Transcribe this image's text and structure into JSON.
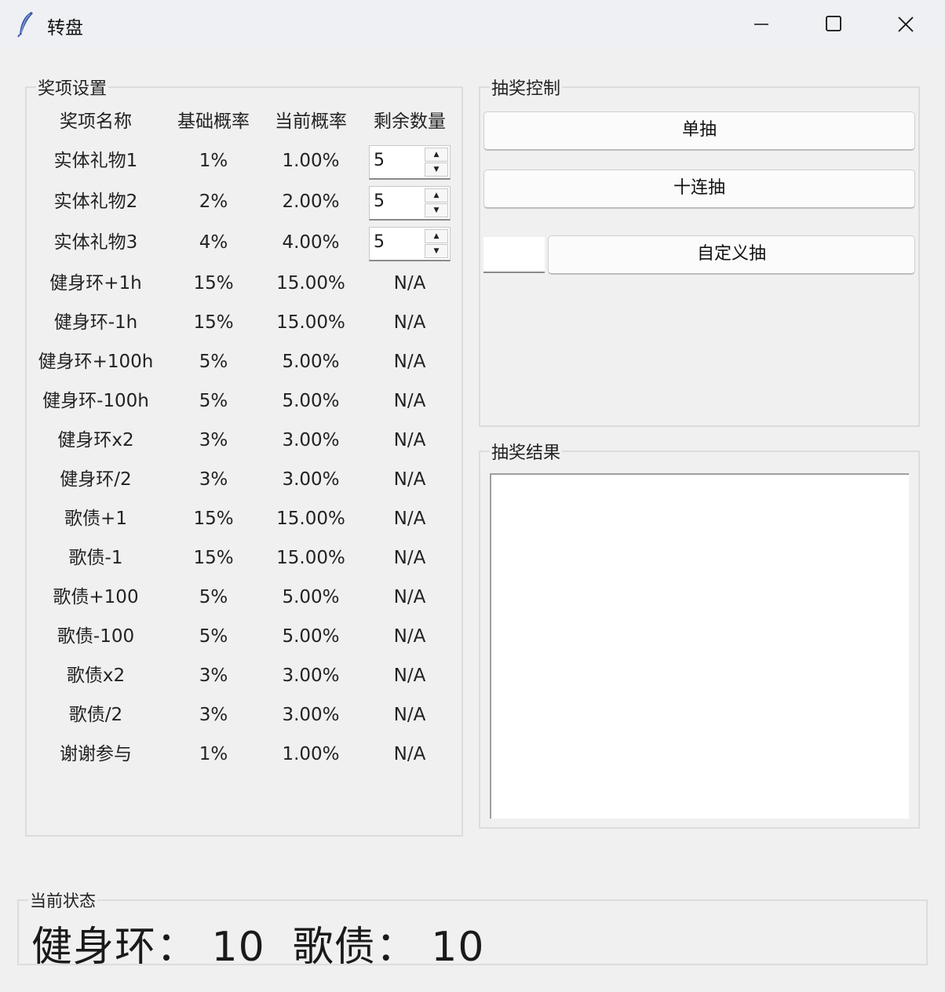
{
  "window": {
    "title": "转盘",
    "icons": {
      "app": "feather-icon",
      "minimize": "minimize-icon",
      "maximize": "maximize-icon",
      "close": "close-icon"
    }
  },
  "prize_settings": {
    "legend": "奖项设置",
    "headers": [
      "奖项名称",
      "基础概率",
      "当前概率",
      "剩余数量"
    ],
    "rows": [
      {
        "name": "实体礼物1",
        "base": "1%",
        "current": "1.00%",
        "remaining": "5"
      },
      {
        "name": "实体礼物2",
        "base": "2%",
        "current": "2.00%",
        "remaining": "5"
      },
      {
        "name": "实体礼物3",
        "base": "4%",
        "current": "4.00%",
        "remaining": "5"
      },
      {
        "name": "健身环+1h",
        "base": "15%",
        "current": "15.00%",
        "remaining": "N/A"
      },
      {
        "name": "健身环-1h",
        "base": "15%",
        "current": "15.00%",
        "remaining": "N/A"
      },
      {
        "name": "健身环+100h",
        "base": "5%",
        "current": "5.00%",
        "remaining": "N/A"
      },
      {
        "name": "健身环-100h",
        "base": "5%",
        "current": "5.00%",
        "remaining": "N/A"
      },
      {
        "name": "健身环x2",
        "base": "3%",
        "current": "3.00%",
        "remaining": "N/A"
      },
      {
        "name": "健身环/2",
        "base": "3%",
        "current": "3.00%",
        "remaining": "N/A"
      },
      {
        "name": "歌债+1",
        "base": "15%",
        "current": "15.00%",
        "remaining": "N/A"
      },
      {
        "name": "歌债-1",
        "base": "15%",
        "current": "15.00%",
        "remaining": "N/A"
      },
      {
        "name": "歌债+100",
        "base": "5%",
        "current": "5.00%",
        "remaining": "N/A"
      },
      {
        "name": "歌债-100",
        "base": "5%",
        "current": "5.00%",
        "remaining": "N/A"
      },
      {
        "name": "歌债x2",
        "base": "3%",
        "current": "3.00%",
        "remaining": "N/A"
      },
      {
        "name": "歌债/2",
        "base": "3%",
        "current": "3.00%",
        "remaining": "N/A"
      },
      {
        "name": "谢谢参与",
        "base": "1%",
        "current": "1.00%",
        "remaining": "N/A"
      }
    ]
  },
  "draw_control": {
    "legend": "抽奖控制",
    "single_label": "单抽",
    "ten_label": "十连抽",
    "custom_label": "自定义抽",
    "custom_count_value": ""
  },
  "draw_result": {
    "legend": "抽奖结果",
    "content": ""
  },
  "status": {
    "legend": "当前状态",
    "text": "健身环： 10  歌债： 10"
  }
}
